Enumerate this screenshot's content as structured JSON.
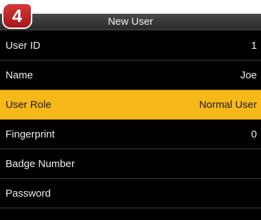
{
  "step_badge": "4",
  "window": {
    "title": "New User"
  },
  "rows": [
    {
      "label": "User ID",
      "value": "1"
    },
    {
      "label": "Name",
      "value": "Joe"
    },
    {
      "label": "User Role",
      "value": "Normal User"
    },
    {
      "label": "Fingerprint",
      "value": "0"
    },
    {
      "label": "Badge Number",
      "value": ""
    },
    {
      "label": "Password",
      "value": ""
    }
  ],
  "selected_row": "User Role",
  "colors": {
    "highlight": "#f7b81a",
    "background": "#000000",
    "badge": "#c4262b"
  }
}
